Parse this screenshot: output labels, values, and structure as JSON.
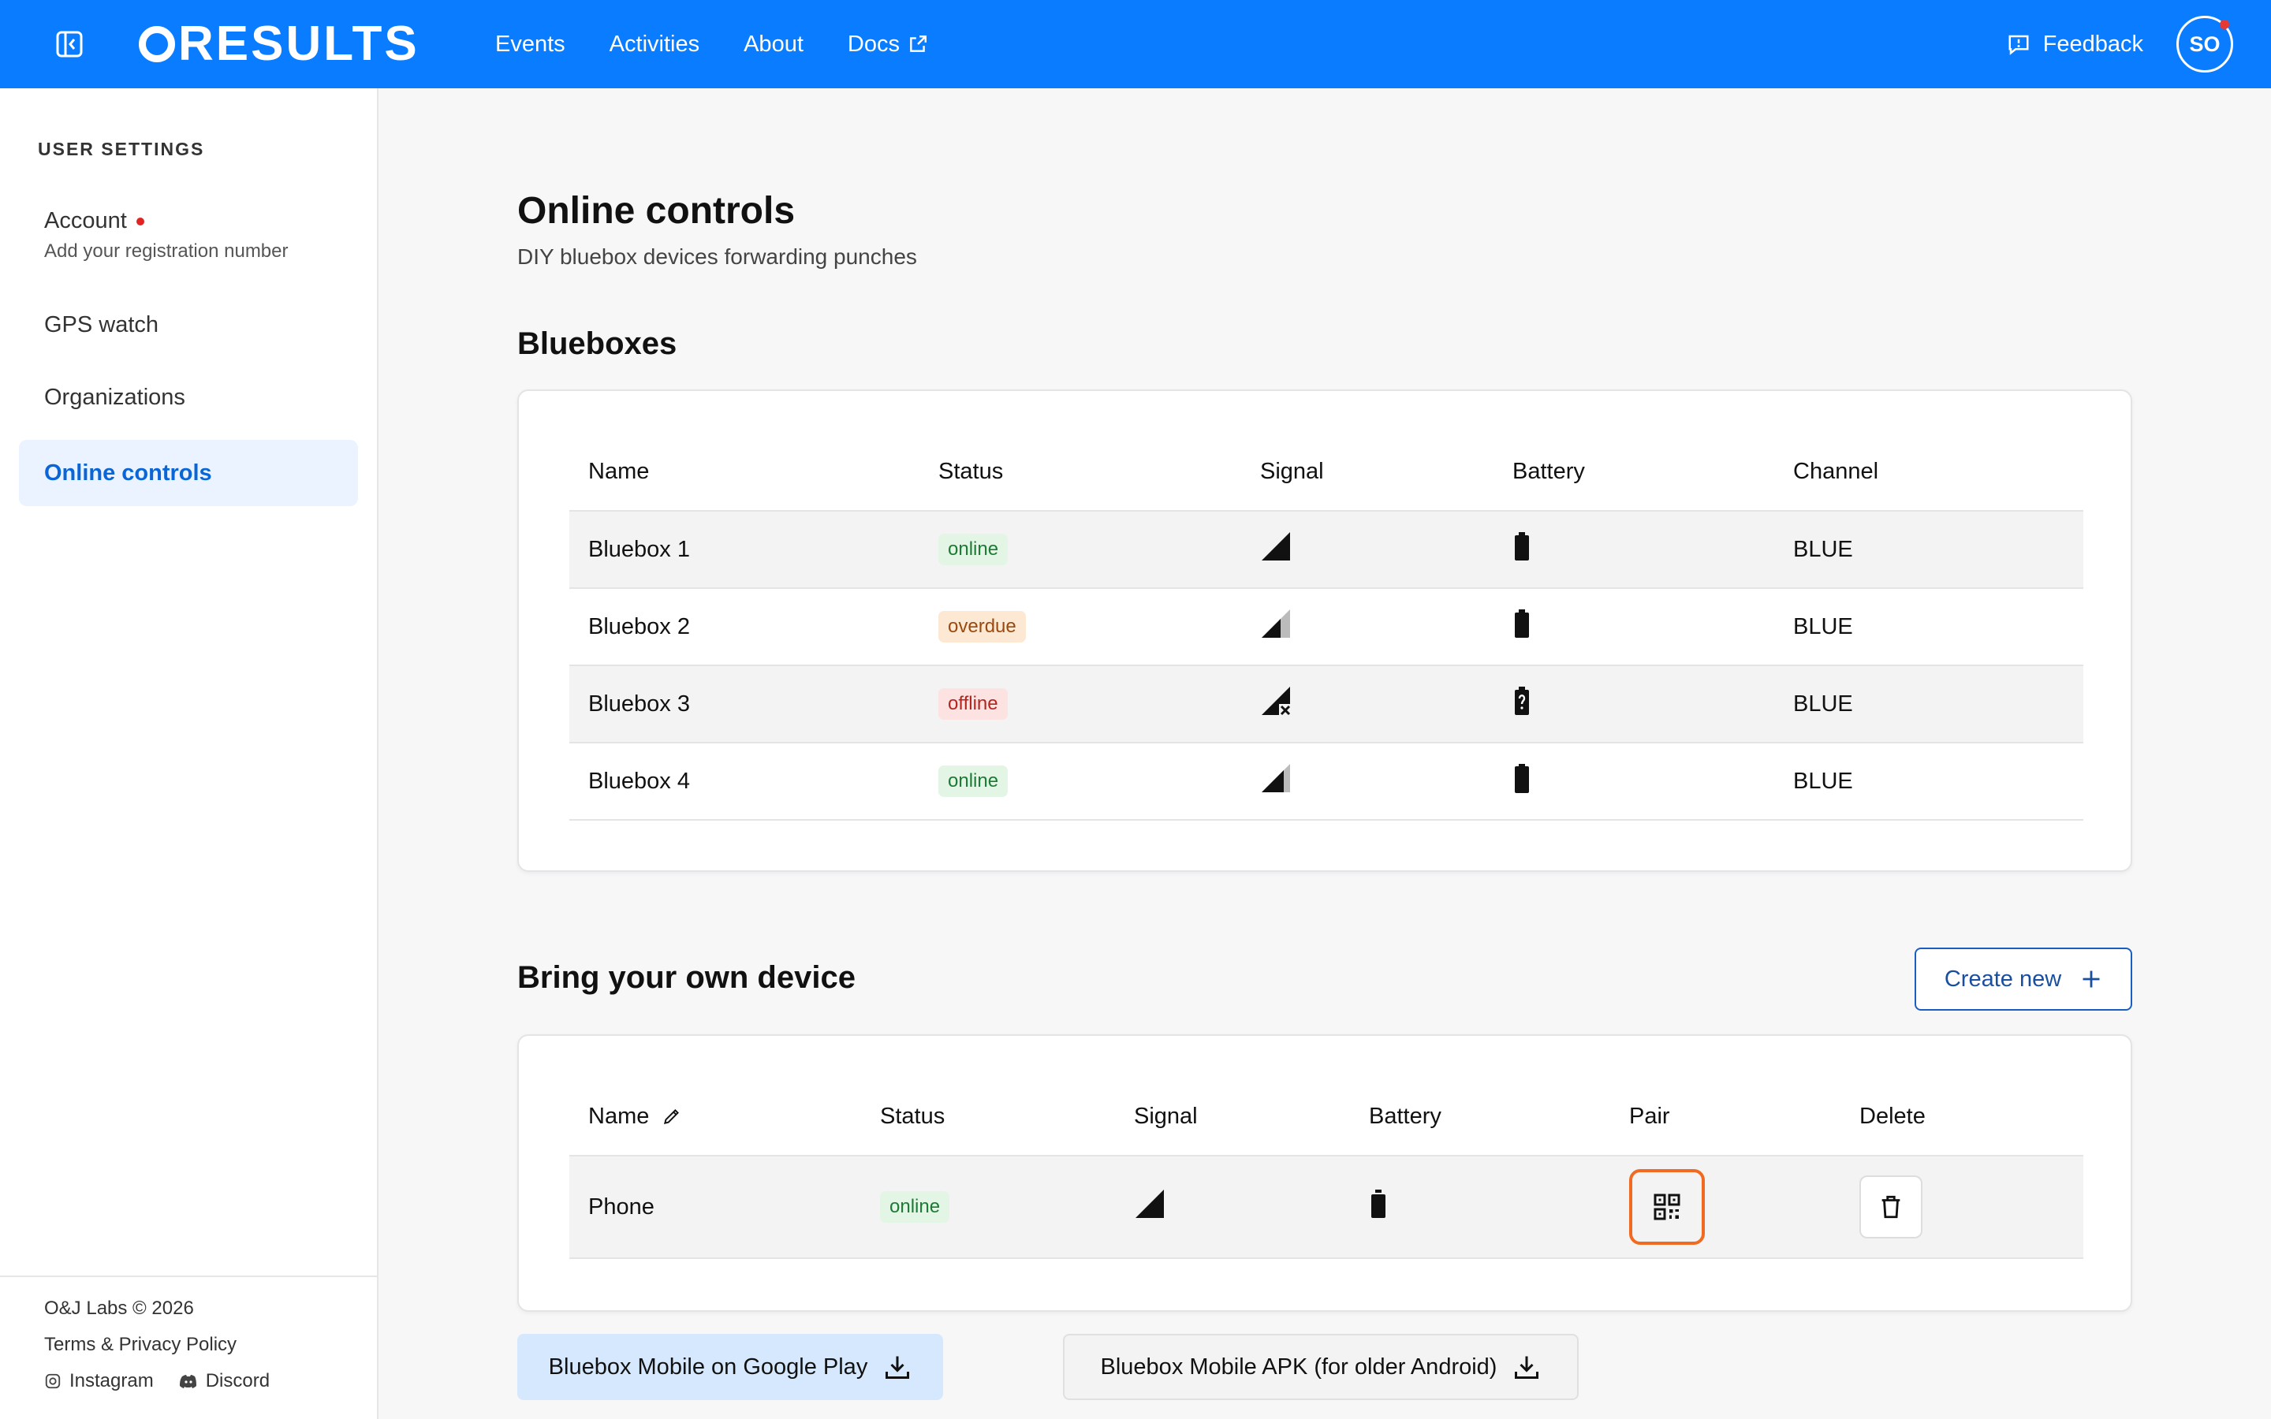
{
  "brand": {
    "name": "RESULTS",
    "accent": "#0a7cff"
  },
  "nav": {
    "items": [
      {
        "label": "Events"
      },
      {
        "label": "Activities"
      },
      {
        "label": "About"
      },
      {
        "label": "Docs"
      }
    ],
    "feedback_label": "Feedback",
    "avatar_initials": "SO"
  },
  "sidebar": {
    "heading": "USER SETTINGS",
    "items": [
      {
        "label": "Account",
        "sub": "Add your registration number"
      },
      {
        "label": "GPS watch"
      },
      {
        "label": "Organizations"
      },
      {
        "label": "Online controls",
        "active": true
      }
    ],
    "footer": {
      "copyright": "O&J Labs © 2026",
      "terms": "Terms & Privacy Policy",
      "instagram": "Instagram",
      "discord": "Discord"
    }
  },
  "main": {
    "title": "Online controls",
    "subtitle": "DIY bluebox devices forwarding punches",
    "blueboxes": {
      "title": "Blueboxes",
      "columns": [
        "Name",
        "Status",
        "Signal",
        "Battery",
        "Channel"
      ],
      "rows": [
        {
          "name": "Bluebox 1",
          "status": "online",
          "signal": "full",
          "battery": "high",
          "channel": "BLUE"
        },
        {
          "name": "Bluebox 2",
          "status": "overdue",
          "signal": "partial",
          "battery": "high",
          "channel": "BLUE"
        },
        {
          "name": "Bluebox 3",
          "status": "offline",
          "signal": "none",
          "battery": "unknown",
          "channel": "BLUE"
        },
        {
          "name": "Bluebox 4",
          "status": "online",
          "signal": "partial",
          "battery": "full",
          "channel": "BLUE"
        }
      ]
    },
    "byod": {
      "title": "Bring your own device",
      "create_label": "Create new",
      "columns": [
        "Name",
        "Status",
        "Signal",
        "Battery",
        "Pair",
        "Delete"
      ],
      "rows": [
        {
          "name": "Phone",
          "status": "online",
          "signal": "full",
          "battery": "high"
        }
      ]
    },
    "downloads": {
      "google_play": "Bluebox Mobile on Google Play",
      "apk": "Bluebox Mobile APK (for older Android)"
    }
  }
}
